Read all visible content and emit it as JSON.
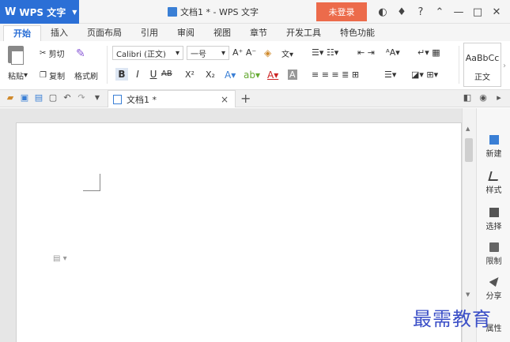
{
  "app": {
    "name": "WPS 文字",
    "logo_glyph": "W"
  },
  "window": {
    "title": "文档1 * - WPS 文字",
    "login_label": "未登录",
    "accent_color": "#2b6fd6",
    "login_color": "#ec6b4b"
  },
  "ribbon_tabs": [
    "开始",
    "插入",
    "页面布局",
    "引用",
    "审阅",
    "视图",
    "章节",
    "开发工具",
    "特色功能"
  ],
  "active_tab": "开始",
  "clipboard": {
    "paste": "粘贴",
    "cut": "剪切",
    "copy": "复制",
    "format_painter": "格式刷"
  },
  "font": {
    "family": "Calibri (正文)",
    "size": "一号"
  },
  "format_buttons": {
    "bold": "B",
    "italic": "I",
    "underline": "U",
    "strike": "AB",
    "superscript": "X²",
    "subscript": "X₂"
  },
  "styles": {
    "sample": "AaBbCc",
    "name": "正文"
  },
  "doc_tab": {
    "name": "文档1 *",
    "close": "×",
    "new": "+"
  },
  "sidebar": [
    {
      "label": "新建",
      "icon": "new-doc-icon"
    },
    {
      "label": "样式",
      "icon": "style-icon"
    },
    {
      "label": "选择",
      "icon": "select-icon"
    },
    {
      "label": "限制",
      "icon": "lock-icon"
    },
    {
      "label": "分享",
      "icon": "share-icon"
    },
    {
      "label": "属性",
      "icon": "properties-icon"
    }
  ],
  "watermark": "最需教育"
}
